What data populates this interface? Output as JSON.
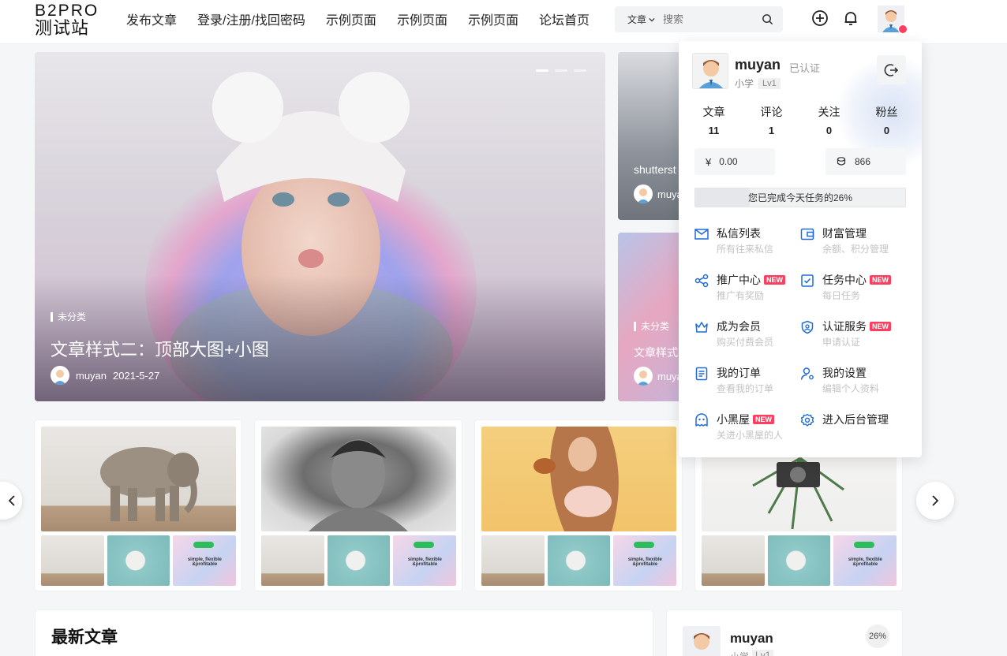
{
  "header": {
    "logo_line1": "B2PRO",
    "logo_line2": "测试站",
    "nav": [
      "发布文章",
      "登录/注册/找回密码",
      "示例页面",
      "示例页面",
      "示例页面",
      "论坛首页"
    ],
    "search_type": "文章",
    "search_placeholder": "搜索"
  },
  "hero": {
    "category": "未分类",
    "title": "文章样式二：顶部大图+小图",
    "author": "muyan",
    "date": "2021-5-27"
  },
  "side_posts": [
    {
      "title": "shutterst",
      "author": "muya"
    },
    {
      "category": "未分类",
      "title": "文章样式",
      "author": "muya"
    }
  ],
  "thumb_caption": "simple, flexible &profitable",
  "latest": {
    "title": "最新文章"
  },
  "user_card": {
    "name": "muyan",
    "level": "小学",
    "lv": "Lv1",
    "progress": "26%"
  },
  "panel": {
    "name": "muyan",
    "verified": "已认证",
    "level": "小学",
    "lv": "Lv1",
    "stats": [
      {
        "label": "文章",
        "value": "11"
      },
      {
        "label": "评论",
        "value": "1"
      },
      {
        "label": "关注",
        "value": "0"
      },
      {
        "label": "粉丝",
        "value": "0"
      }
    ],
    "money_symbol": "¥",
    "money": "0.00",
    "credits": "866",
    "task_progress_text": "您已完成今天任务的26%",
    "task_progress": 0.26,
    "new_label": "NEW",
    "menu": [
      {
        "title": "私信列表",
        "sub": "所有往来私信",
        "icon": "mail-icon",
        "new": false
      },
      {
        "title": "财富管理",
        "sub": "余额、积分管理",
        "icon": "wallet-icon",
        "new": false
      },
      {
        "title": "推广中心",
        "sub": "推广有奖励",
        "icon": "share-icon",
        "new": true
      },
      {
        "title": "任务中心",
        "sub": "每日任务",
        "icon": "task-icon",
        "new": true
      },
      {
        "title": "成为会员",
        "sub": "购买付费会员",
        "icon": "crown-icon",
        "new": false
      },
      {
        "title": "认证服务",
        "sub": "申请认证",
        "icon": "shield-icon",
        "new": true
      },
      {
        "title": "我的订单",
        "sub": "查看我的订单",
        "icon": "order-icon",
        "new": false
      },
      {
        "title": "我的设置",
        "sub": "编辑个人资料",
        "icon": "user-settings-icon",
        "new": false
      },
      {
        "title": "小黑屋",
        "sub": "关进小黑屋的人",
        "icon": "ghost-icon",
        "new": true
      },
      {
        "title": "进入后台管理",
        "sub": "",
        "icon": "gear-icon",
        "new": false
      }
    ]
  },
  "colors": {
    "accent": "#1e6bd8",
    "new_badge": "#ff3e5f"
  }
}
